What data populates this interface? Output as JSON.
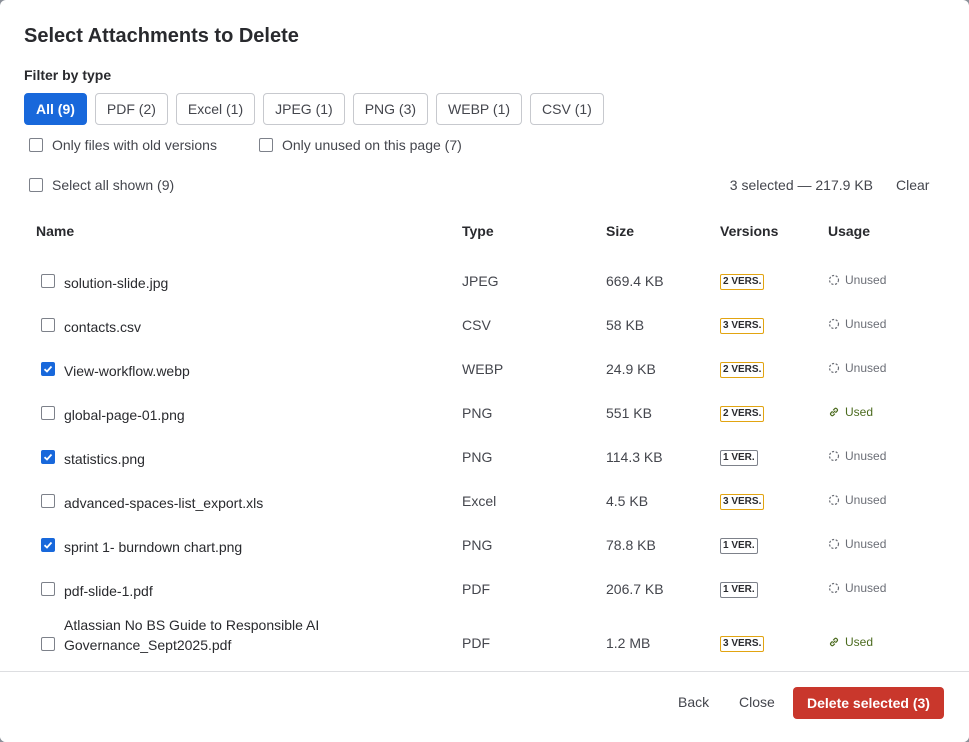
{
  "dialog": {
    "title": "Select Attachments to Delete",
    "filter_label": "Filter by type"
  },
  "filters": [
    {
      "label": "All (9)",
      "active": true
    },
    {
      "label": "PDF (2)",
      "active": false
    },
    {
      "label": "Excel (1)",
      "active": false
    },
    {
      "label": "JPEG (1)",
      "active": false
    },
    {
      "label": "PNG (3)",
      "active": false
    },
    {
      "label": "WEBP (1)",
      "active": false
    },
    {
      "label": "CSV (1)",
      "active": false
    }
  ],
  "options": {
    "old_versions": {
      "label": "Only files with old versions",
      "checked": false
    },
    "unused": {
      "label": "Only unused on this page (7)",
      "checked": false
    },
    "select_all": {
      "label": "Select all shown (9)",
      "checked": false
    }
  },
  "selection": {
    "summary": "3 selected — 217.9 KB",
    "clear_label": "Clear"
  },
  "table": {
    "headers": {
      "name": "Name",
      "type": "Type",
      "size": "Size",
      "versions": "Versions",
      "usage": "Usage"
    },
    "rows": [
      {
        "name": "solution-slide.jpg",
        "type": "JPEG",
        "size": "669.4 KB",
        "versions": "2 VERS.",
        "usage": "Unused",
        "checked": false
      },
      {
        "name": "contacts.csv",
        "type": "CSV",
        "size": "58 KB",
        "versions": "3 VERS.",
        "usage": "Unused",
        "checked": false
      },
      {
        "name": "View-workflow.webp",
        "type": "WEBP",
        "size": "24.9 KB",
        "versions": "2 VERS.",
        "usage": "Unused",
        "checked": true
      },
      {
        "name": "global-page-01.png",
        "type": "PNG",
        "size": "551 KB",
        "versions": "2 VERS.",
        "usage": "Used",
        "checked": false
      },
      {
        "name": "statistics.png",
        "type": "PNG",
        "size": "114.3 KB",
        "versions": "1 VER.",
        "usage": "Unused",
        "checked": true
      },
      {
        "name": "advanced-spaces-list_export.xls",
        "type": "Excel",
        "size": "4.5 KB",
        "versions": "3 VERS.",
        "usage": "Unused",
        "checked": false
      },
      {
        "name": "sprint 1- burndown chart.png",
        "type": "PNG",
        "size": "78.8 KB",
        "versions": "1 VER.",
        "usage": "Unused",
        "checked": true
      },
      {
        "name": "pdf-slide-1.pdf",
        "type": "PDF",
        "size": "206.7 KB",
        "versions": "1 VER.",
        "usage": "Unused",
        "checked": false
      },
      {
        "name": "Atlassian No BS Guide to Responsible AI\nGovernance_Sept2025.pdf",
        "type": "PDF",
        "size": "1.2 MB",
        "versions": "3 VERS.",
        "usage": "Used",
        "checked": false
      }
    ]
  },
  "footer": {
    "back_label": "Back",
    "close_label": "Close",
    "delete_label": "Delete selected (3)"
  },
  "colors": {
    "primary": "#1868db",
    "danger": "#c9372c",
    "multi_version_border": "#e2a411",
    "used": "#4c6b1f"
  },
  "icons": {
    "unused": "dashed-circle-icon",
    "used": "link-icon"
  }
}
